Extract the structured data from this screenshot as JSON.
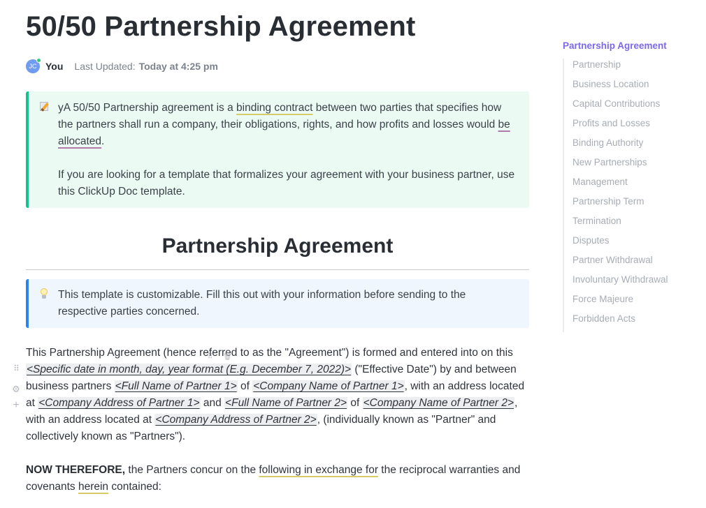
{
  "document": {
    "title": "50/50 Partnership Agreement",
    "author": {
      "initials": "JC",
      "name": "You",
      "status_color": "#2ecc71"
    },
    "last_updated_label": "Last Updated:",
    "last_updated_value": "Today at 4:25 pm"
  },
  "intro_callout": {
    "icon": "memo-icon",
    "accent_color": "#12c48b",
    "para1_a": "yA 50/50 Partnership agreement is a ",
    "para1_link1": "binding contract",
    "para1_b": " between two parties that specifies how the partners shall run a company, their obligations, rights, and how profits and losses would ",
    "para1_link2": "be allocated",
    "para1_c": ".",
    "para2": "If you are looking for a template that formalizes your agreement with your business partner, use this ClickUp Doc template."
  },
  "section": {
    "heading": "Partnership Agreement"
  },
  "tip_callout": {
    "icon": "lightbulb-icon",
    "accent_color": "#2c82f0",
    "text": "This template is customizable. Fill this out with your information before sending to the respective parties concerned."
  },
  "agreement_paragraph": {
    "t1": "This Partnership Agreement (hence referred to as the \"Agreement\") is formed and entered into on this ",
    "ph_date": "<Specific date in month, day, year format (E.g. December 7, 2022)>",
    "t2": " (\"Effective Date\") by and between business partners ",
    "ph_name1": "<Full Name of Partner 1>",
    "t3": " of ",
    "ph_company1": "<Company Name of Partner 1>",
    "t4": ", with an address located at ",
    "ph_address1": "<Company Address of Partner 1>",
    "t5": " and ",
    "ph_name2": "<Full Name of Partner 2>",
    "t6": " of ",
    "ph_company2": "<Company Name of Partner 2>",
    "t7": ", with an address located at ",
    "ph_address2": "<Company Address of Partner 2>",
    "t8": ", (individually known as \"Partner\" and collectively known as \"Partners\")."
  },
  "now_therefore_paragraph": {
    "bold": "NOW THEREFORE,",
    "t1": " the Partners concur on the ",
    "link1": "following in exchange for",
    "t2": " the reciprocal warranties and covenants ",
    "link2": "herein",
    "t3": " contained:"
  },
  "block_tools": {
    "drag_handle": "⠿",
    "settings": "⚙",
    "add": "+",
    "hover_drag": "⠿",
    "hover_delete": "🗑"
  },
  "table_of_contents": {
    "title": "Partnership Agreement",
    "accent_color": "#7b68ee",
    "items": [
      "Partnership",
      "Business Location",
      "Capital Contributions",
      "Profits and Losses",
      "Binding Authority",
      "New Partnerships",
      "Management",
      "Partnership Term",
      "Termination",
      "Disputes",
      "Partner Withdrawal",
      "Involuntary Withdrawal",
      "Force Majeure",
      "Forbidden Acts"
    ]
  }
}
